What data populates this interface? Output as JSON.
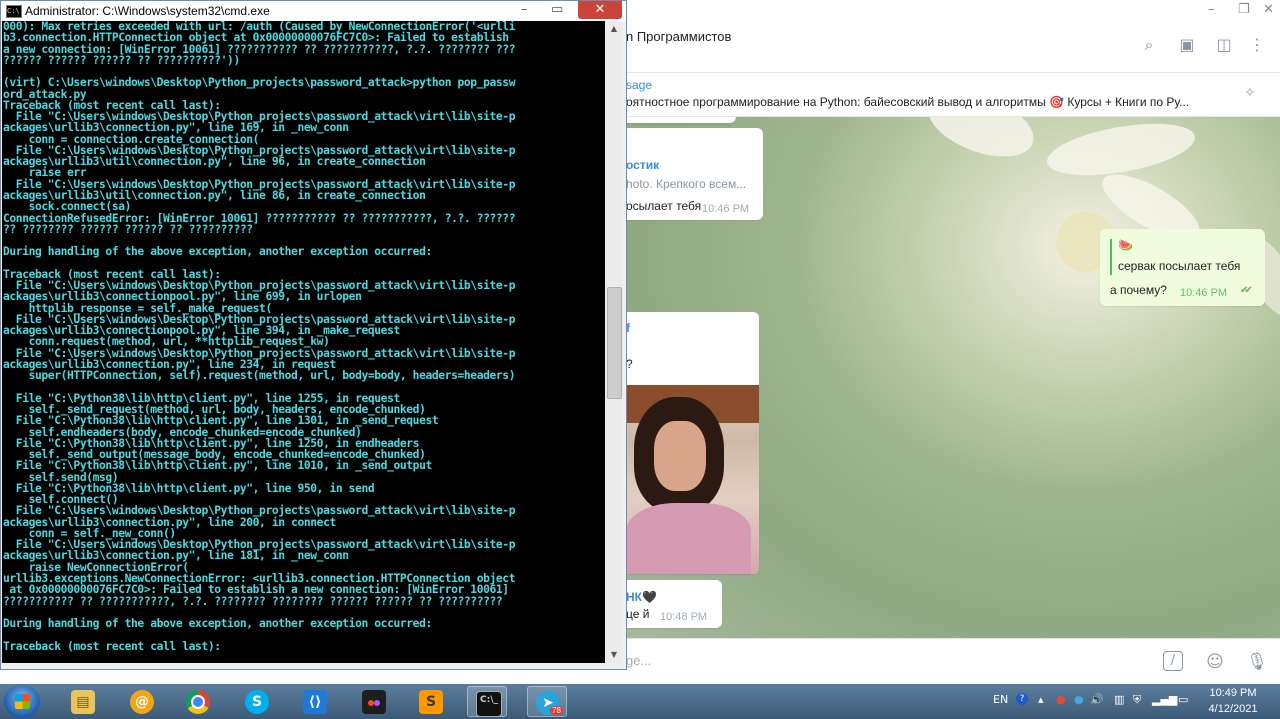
{
  "telegram": {
    "chat_title": "n Программистов",
    "pinned": {
      "title": "sage",
      "text": "оятностное программирование на Python: байесовский вывод и алгоритмы 🎯 Курсы + Книги по Ру..."
    },
    "messages": [
      {
        "name": "остик",
        "line1": "hoto. Крепкого всем...",
        "line2": "осылает тебя",
        "time": "10:46 PM"
      },
      {
        "reply_emoji": "🍉",
        "reply_text": "сервак посылает тебя",
        "text": "а почему?",
        "time": "10:46 PM",
        "status": "✔✔"
      },
      {
        "name": "f",
        "text": "?"
      },
      {
        "name": "НК🖤",
        "text": "це й",
        "time": "10:48 PM"
      }
    ],
    "input_placeholder": "ge..."
  },
  "cmd": {
    "title": "Administrator: C:\\Windows\\system32\\cmd.exe",
    "lines": [
      "000): Max retries exceeded with url: /auth (Caused by NewConnectionError('<urlli",
      "b3.connection.HTTPConnection object at 0x00000000076FC7C0>: Failed to establish",
      "a new connection: [WinError 10061] ??????????? ?? ???????????, ?.?. ???????? ???",
      "?????? ?????? ?????? ?? ??????????'))",
      "",
      "(virt) C:\\Users\\windows\\Desktop\\Python_projects\\password_attack>python pop_passw",
      "ord_attack.py",
      "Traceback (most recent call last):",
      "  File \"C:\\Users\\windows\\Desktop\\Python_projects\\password_attack\\virt\\lib\\site-p",
      "ackages\\urllib3\\connection.py\", line 169, in _new_conn",
      "    conn = connection.create_connection(",
      "  File \"C:\\Users\\windows\\Desktop\\Python_projects\\password_attack\\virt\\lib\\site-p",
      "ackages\\urllib3\\util\\connection.py\", line 96, in create_connection",
      "    raise err",
      "  File \"C:\\Users\\windows\\Desktop\\Python_projects\\password_attack\\virt\\lib\\site-p",
      "ackages\\urllib3\\util\\connection.py\", line 86, in create_connection",
      "    sock.connect(sa)",
      "ConnectionRefusedError: [WinError 10061] ??????????? ?? ???????????, ?.?. ??????",
      "?? ???????? ?????? ?????? ?? ??????????",
      "",
      "During handling of the above exception, another exception occurred:",
      "",
      "Traceback (most recent call last):",
      "  File \"C:\\Users\\windows\\Desktop\\Python_projects\\password_attack\\virt\\lib\\site-p",
      "ackages\\urllib3\\connectionpool.py\", line 699, in urlopen",
      "    httplib_response = self._make_request(",
      "  File \"C:\\Users\\windows\\Desktop\\Python_projects\\password_attack\\virt\\lib\\site-p",
      "ackages\\urllib3\\connectionpool.py\", line 394, in _make_request",
      "    conn.request(method, url, **httplib_request_kw)",
      "  File \"C:\\Users\\windows\\Desktop\\Python_projects\\password_attack\\virt\\lib\\site-p",
      "ackages\\urllib3\\connection.py\", line 234, in request",
      "    super(HTTPConnection, self).request(method, url, body=body, headers=headers)",
      "",
      "  File \"C:\\Python38\\lib\\http\\client.py\", line 1255, in request",
      "    self._send_request(method, url, body, headers, encode_chunked)",
      "  File \"C:\\Python38\\lib\\http\\client.py\", line 1301, in _send_request",
      "    self.endheaders(body, encode_chunked=encode_chunked)",
      "  File \"C:\\Python38\\lib\\http\\client.py\", line 1250, in endheaders",
      "    self._send_output(message_body, encode_chunked=encode_chunked)",
      "  File \"C:\\Python38\\lib\\http\\client.py\", line 1010, in _send_output",
      "    self.send(msg)",
      "  File \"C:\\Python38\\lib\\http\\client.py\", line 950, in send",
      "    self.connect()",
      "  File \"C:\\Users\\windows\\Desktop\\Python_projects\\password_attack\\virt\\lib\\site-p",
      "ackages\\urllib3\\connection.py\", line 200, in connect",
      "    conn = self._new_conn()",
      "  File \"C:\\Users\\windows\\Desktop\\Python_projects\\password_attack\\virt\\lib\\site-p",
      "ackages\\urllib3\\connection.py\", line 181, in _new_conn",
      "    raise NewConnectionError(",
      "urllib3.exceptions.NewConnectionError: <urllib3.connection.HTTPConnection object",
      " at 0x00000000076FC7C0>: Failed to establish a new connection: [WinError 10061]",
      "??????????? ?? ???????????, ?.?. ???????? ???????? ?????? ?????? ?? ??????????",
      "",
      "During handling of the above exception, another exception occurred:",
      "",
      "Traceback (most recent call last):"
    ]
  },
  "taskbar": {
    "apps": [
      "start",
      "explorer",
      "at-app",
      "chrome",
      "skype",
      "vscode",
      "figma",
      "sublime",
      "cmd",
      "telegram"
    ],
    "telegram_badge": "78",
    "lang": "EN",
    "time": "10:49 PM",
    "date": "4/12/2021"
  },
  "colors": {
    "console_text": "#4fd9e0",
    "console_bg": "#000000",
    "accent": "#3a8fd1"
  }
}
